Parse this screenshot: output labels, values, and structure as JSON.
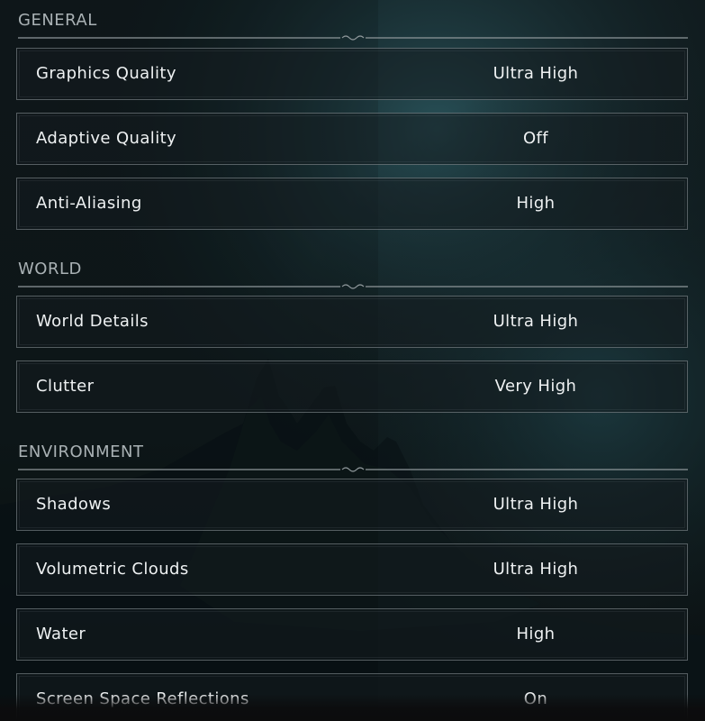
{
  "colors": {
    "background": "#0b1113",
    "accent_teal": "#2d5a63",
    "text": "#eef1f2",
    "header_text": "#a9b1b4",
    "row_border": "#aab4b8"
  },
  "sections": [
    {
      "title": "GENERAL",
      "settings": [
        {
          "label": "Graphics Quality",
          "value": "Ultra High"
        },
        {
          "label": "Adaptive Quality",
          "value": "Off"
        },
        {
          "label": "Anti-Aliasing",
          "value": "High"
        }
      ]
    },
    {
      "title": "WORLD",
      "settings": [
        {
          "label": "World Details",
          "value": "Ultra High"
        },
        {
          "label": "Clutter",
          "value": "Very High"
        }
      ]
    },
    {
      "title": "ENVIRONMENT",
      "settings": [
        {
          "label": "Shadows",
          "value": "Ultra High"
        },
        {
          "label": "Volumetric Clouds",
          "value": "Ultra High"
        },
        {
          "label": "Water",
          "value": "High"
        },
        {
          "label": "Screen Space Reflections",
          "value": "On"
        }
      ]
    }
  ]
}
